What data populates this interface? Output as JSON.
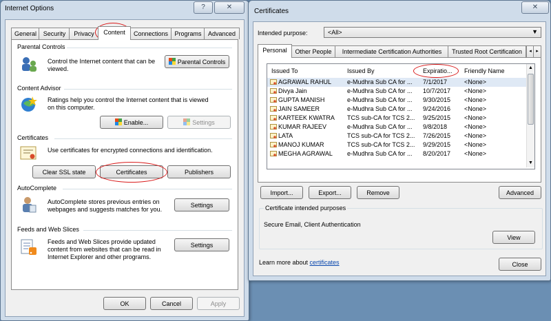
{
  "internet_options": {
    "title": "Internet Options",
    "title_buttons": {
      "help": "?",
      "close": "✕"
    },
    "tabs": [
      "General",
      "Security",
      "Privacy",
      "Content",
      "Connections",
      "Programs",
      "Advanced"
    ],
    "active_tab": "Content",
    "sections": {
      "parental_controls": {
        "heading": "Parental Controls",
        "text": "Control the Internet content that can be viewed.",
        "button": "Parental Controls"
      },
      "content_advisor": {
        "heading": "Content Advisor",
        "text": "Ratings help you control the Internet content that is viewed on this computer.",
        "enable_button": "Enable...",
        "settings_button": "Settings"
      },
      "certificates": {
        "heading": "Certificates",
        "text": "Use certificates for encrypted connections and identification.",
        "clear_button": "Clear SSL state",
        "certificates_button": "Certificates",
        "publishers_button": "Publishers"
      },
      "autocomplete": {
        "heading": "AutoComplete",
        "text": "AutoComplete stores previous entries on webpages and suggests matches for you.",
        "settings_button": "Settings"
      },
      "feeds": {
        "heading": "Feeds and Web Slices",
        "text": "Feeds and Web Slices provide updated content from websites that can be read in Internet Explorer and other programs.",
        "settings_button": "Settings"
      }
    },
    "footer": {
      "ok": "OK",
      "cancel": "Cancel",
      "apply": "Apply"
    }
  },
  "certificates": {
    "title": "Certificates",
    "close": "✕",
    "intended_purpose_label": "Intended purpose:",
    "intended_purpose_value": "<All>",
    "tabs": [
      "Personal",
      "Other People",
      "Intermediate Certification Authorities",
      "Trusted Root Certification"
    ],
    "active_tab": "Personal",
    "columns": [
      "Issued To",
      "Issued By",
      "Expiratio...",
      "Friendly Name"
    ],
    "rows": [
      {
        "issued_to": "AGRAWAL RAHUL",
        "issued_by": "e-Mudhra Sub CA for ...",
        "expiration": "7/1/2017",
        "friendly": "<None>"
      },
      {
        "issued_to": "Divya Jain",
        "issued_by": "e-Mudhra Sub CA for ...",
        "expiration": "10/7/2017",
        "friendly": "<None>"
      },
      {
        "issued_to": "GUPTA MANISH",
        "issued_by": "e-Mudhra Sub CA for ...",
        "expiration": "9/30/2015",
        "friendly": "<None>"
      },
      {
        "issued_to": "JAIN SAMEER",
        "issued_by": "e-Mudhra Sub CA for ...",
        "expiration": "9/24/2016",
        "friendly": "<None>"
      },
      {
        "issued_to": "KARTEEK KWATRA",
        "issued_by": "TCS sub-CA for TCS 2...",
        "expiration": "9/25/2015",
        "friendly": "<None>"
      },
      {
        "issued_to": "KUMAR RAJEEV",
        "issued_by": "e-Mudhra Sub CA for ...",
        "expiration": "9/8/2018",
        "friendly": "<None>"
      },
      {
        "issued_to": "LATA",
        "issued_by": "TCS sub-CA for TCS 2...",
        "expiration": "7/26/2015",
        "friendly": "<None>"
      },
      {
        "issued_to": "MANOJ KUMAR",
        "issued_by": "TCS sub-CA for TCS 2...",
        "expiration": "9/29/2015",
        "friendly": "<None>"
      },
      {
        "issued_to": "MEGHA AGRAWAL",
        "issued_by": "e-Mudhra Sub CA for ...",
        "expiration": "8/20/2017",
        "friendly": "<None>"
      }
    ],
    "buttons": {
      "import": "Import...",
      "export": "Export...",
      "remove": "Remove",
      "advanced": "Advanced"
    },
    "purposes_heading": "Certificate intended purposes",
    "purposes_value": "Secure Email, Client Authentication",
    "view_button": "View",
    "learn_prefix": "Learn more about ",
    "learn_link": "certificates",
    "close_button": "Close"
  },
  "colors": {
    "annotation_red": "#d91b1b",
    "link_blue": "#0645ad",
    "selection": "#dfe9f5"
  }
}
